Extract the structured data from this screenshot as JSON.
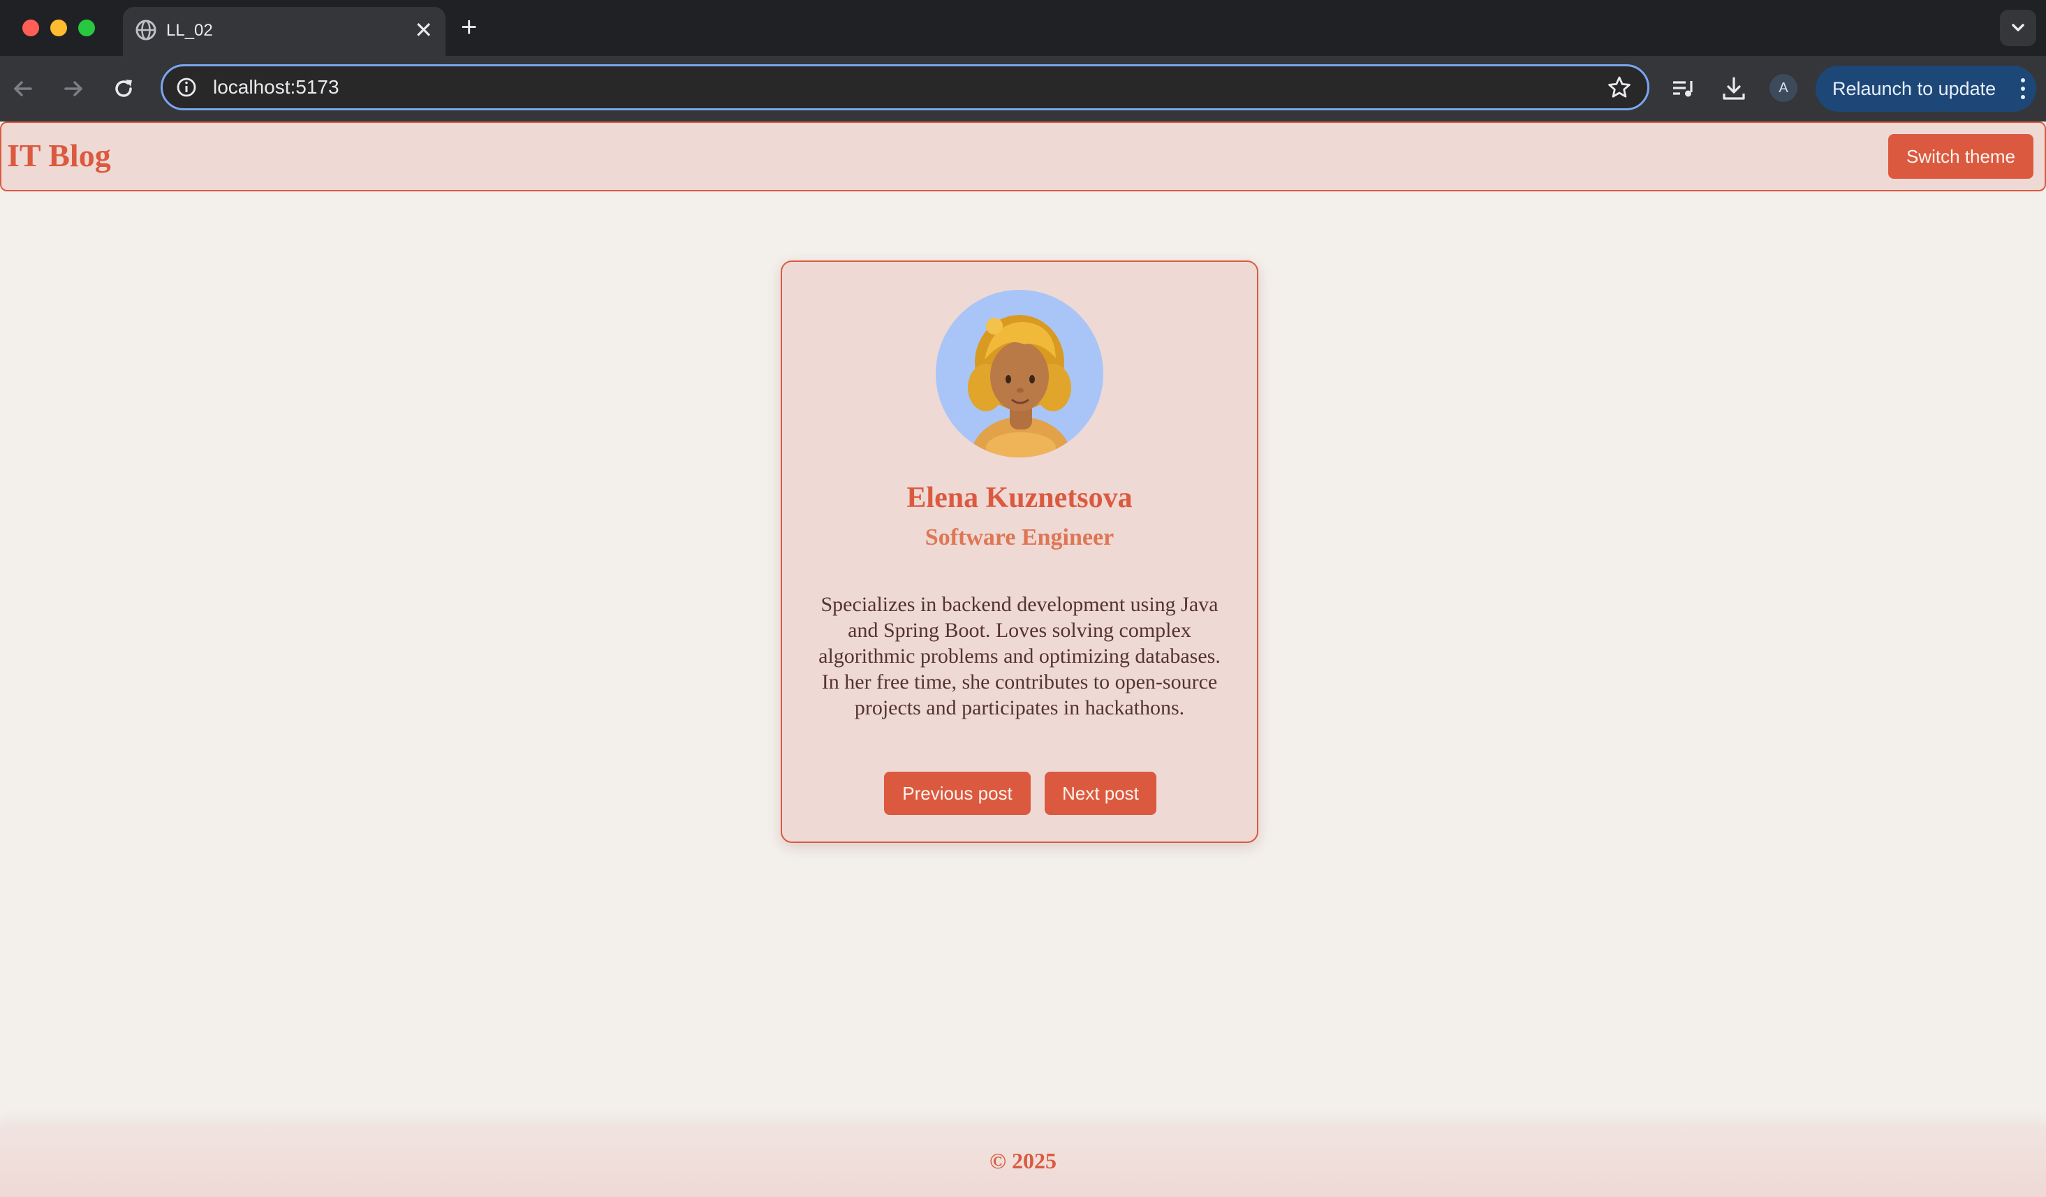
{
  "browser": {
    "tab_title": "LL_02",
    "url": "localhost:5173",
    "profile_initial": "A",
    "relaunch_label": "Relaunch to update"
  },
  "header": {
    "title": "IT Blog",
    "switch_theme_label": "Switch theme"
  },
  "card": {
    "name": "Elena Kuznetsova",
    "role": "Software Engineer",
    "bio": "Specializes in backend development using Java and Spring Boot. Loves solving complex algorithmic problems and optimizing databases. In her free time, she contributes to open-source projects and participates in hackathons.",
    "prev_label": "Previous post",
    "next_label": "Next post"
  },
  "footer": {
    "copyright": "© 2025"
  },
  "colors": {
    "accent": "#db5a3f",
    "page_bg": "#f3efeb",
    "card_bg": "#eed9d5",
    "avatar_bg": "#a9c5f7"
  }
}
